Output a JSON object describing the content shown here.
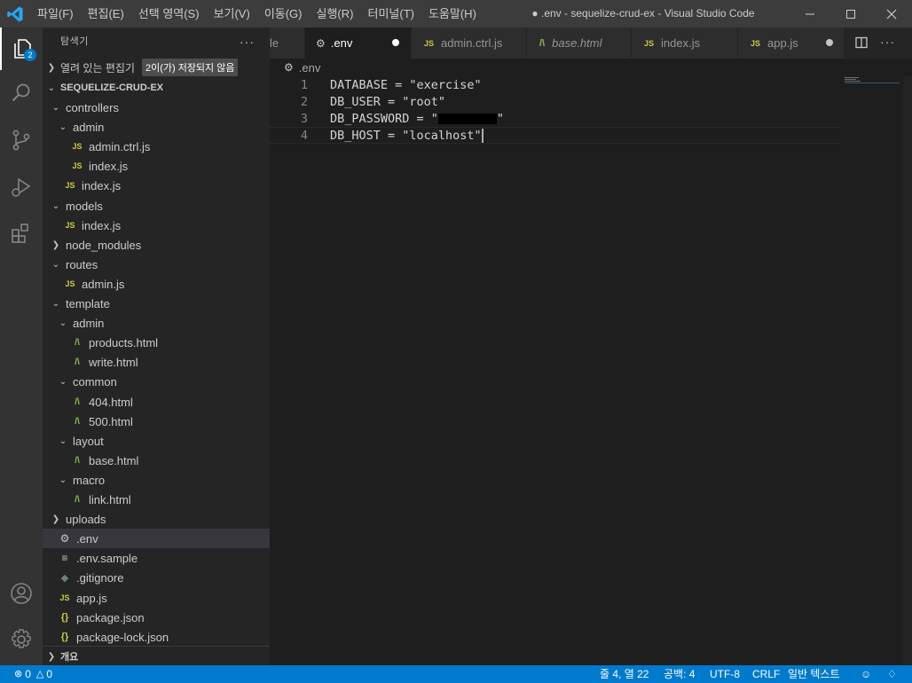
{
  "window": {
    "title": "● .env - sequelize-crud-ex - Visual Studio Code",
    "menu": [
      "파일(F)",
      "편집(E)",
      "선택 영역(S)",
      "보기(V)",
      "이동(G)",
      "실행(R)",
      "터미널(T)",
      "도움말(H)"
    ]
  },
  "activity_bar": {
    "explorer_badge": "2",
    "icons": [
      "files-icon",
      "search-icon",
      "source-control-icon",
      "run-debug-icon",
      "extensions-icon",
      "account-icon",
      "settings-gear-icon"
    ]
  },
  "sidebar": {
    "title": "탐색기",
    "more_label": "···",
    "open_editors": {
      "label": "열려 있는 편집기",
      "badge": "2이(가) 저장되지 않음"
    },
    "project": {
      "label": "SEQUELIZE-CRUD-EX"
    },
    "tree": [
      {
        "label": "controllers",
        "type": "folder-open",
        "depth": 1
      },
      {
        "label": "admin",
        "type": "folder-open",
        "depth": 2
      },
      {
        "label": "admin.ctrl.js",
        "type": "js",
        "depth": 3
      },
      {
        "label": "index.js",
        "type": "js",
        "depth": 3
      },
      {
        "label": "index.js",
        "type": "js",
        "depth": 2
      },
      {
        "label": "models",
        "type": "folder-open",
        "depth": 1
      },
      {
        "label": "index.js",
        "type": "js",
        "depth": 2
      },
      {
        "label": "node_modules",
        "type": "folder-closed",
        "depth": 1
      },
      {
        "label": "routes",
        "type": "folder-open",
        "depth": 1
      },
      {
        "label": "admin.js",
        "type": "js",
        "depth": 2
      },
      {
        "label": "template",
        "type": "folder-open",
        "depth": 1
      },
      {
        "label": "admin",
        "type": "folder-open",
        "depth": 2
      },
      {
        "label": "products.html",
        "type": "html",
        "depth": 3
      },
      {
        "label": "write.html",
        "type": "html",
        "depth": 3
      },
      {
        "label": "common",
        "type": "folder-open",
        "depth": 2
      },
      {
        "label": "404.html",
        "type": "html",
        "depth": 3
      },
      {
        "label": "500.html",
        "type": "html",
        "depth": 3
      },
      {
        "label": "layout",
        "type": "folder-open",
        "depth": 2
      },
      {
        "label": "base.html",
        "type": "html",
        "depth": 3
      },
      {
        "label": "macro",
        "type": "folder-open",
        "depth": 2
      },
      {
        "label": "link.html",
        "type": "html",
        "depth": 3
      },
      {
        "label": "uploads",
        "type": "folder-closed",
        "depth": 1
      },
      {
        "label": ".env",
        "type": "gear",
        "depth": 1,
        "selected": true
      },
      {
        "label": ".env.sample",
        "type": "lines",
        "depth": 1
      },
      {
        "label": ".gitignore",
        "type": "git",
        "depth": 1
      },
      {
        "label": "app.js",
        "type": "js",
        "depth": 1
      },
      {
        "label": "package.json",
        "type": "json",
        "depth": 1
      },
      {
        "label": "package-lock.json",
        "type": "json",
        "depth": 1
      }
    ],
    "outline": {
      "label": "개요"
    }
  },
  "tabs": [
    {
      "label": "le",
      "icon": "none",
      "active": false,
      "italic": false,
      "dirty": false
    },
    {
      "label": ".env",
      "icon": "gear",
      "active": true,
      "italic": false,
      "dirty": true
    },
    {
      "label": "admin.ctrl.js",
      "icon": "js",
      "active": false,
      "italic": false,
      "dirty": false
    },
    {
      "label": "base.html",
      "icon": "html",
      "active": false,
      "italic": true,
      "dirty": false
    },
    {
      "label": "index.js",
      "icon": "js",
      "active": false,
      "italic": false,
      "dirty": false
    },
    {
      "label": "app.js",
      "icon": "js",
      "active": false,
      "italic": false,
      "dirty": true
    }
  ],
  "breadcrumb": {
    "file": ".env"
  },
  "editor": {
    "lines": [
      {
        "num": "1",
        "text": "DATABASE = \"exercise\""
      },
      {
        "num": "2",
        "text": "DB_USER = \"root\""
      },
      {
        "num": "3",
        "text": "DB_PASSWORD = \"",
        "redacted": true,
        "suffix": "\""
      },
      {
        "num": "4",
        "text": "DB_HOST = \"localhost\"",
        "cursor": true
      }
    ]
  },
  "status_bar": {
    "errors": "0",
    "warnings": "0",
    "position": "줄 4, 열 22",
    "spaces": "공백: 4",
    "encoding": "UTF-8",
    "eol": "CRLF",
    "language": "일반 텍스트"
  },
  "colors": {
    "accent": "#007acc",
    "html_icon": "#8dc149",
    "js_icon": "#cbcb41"
  }
}
